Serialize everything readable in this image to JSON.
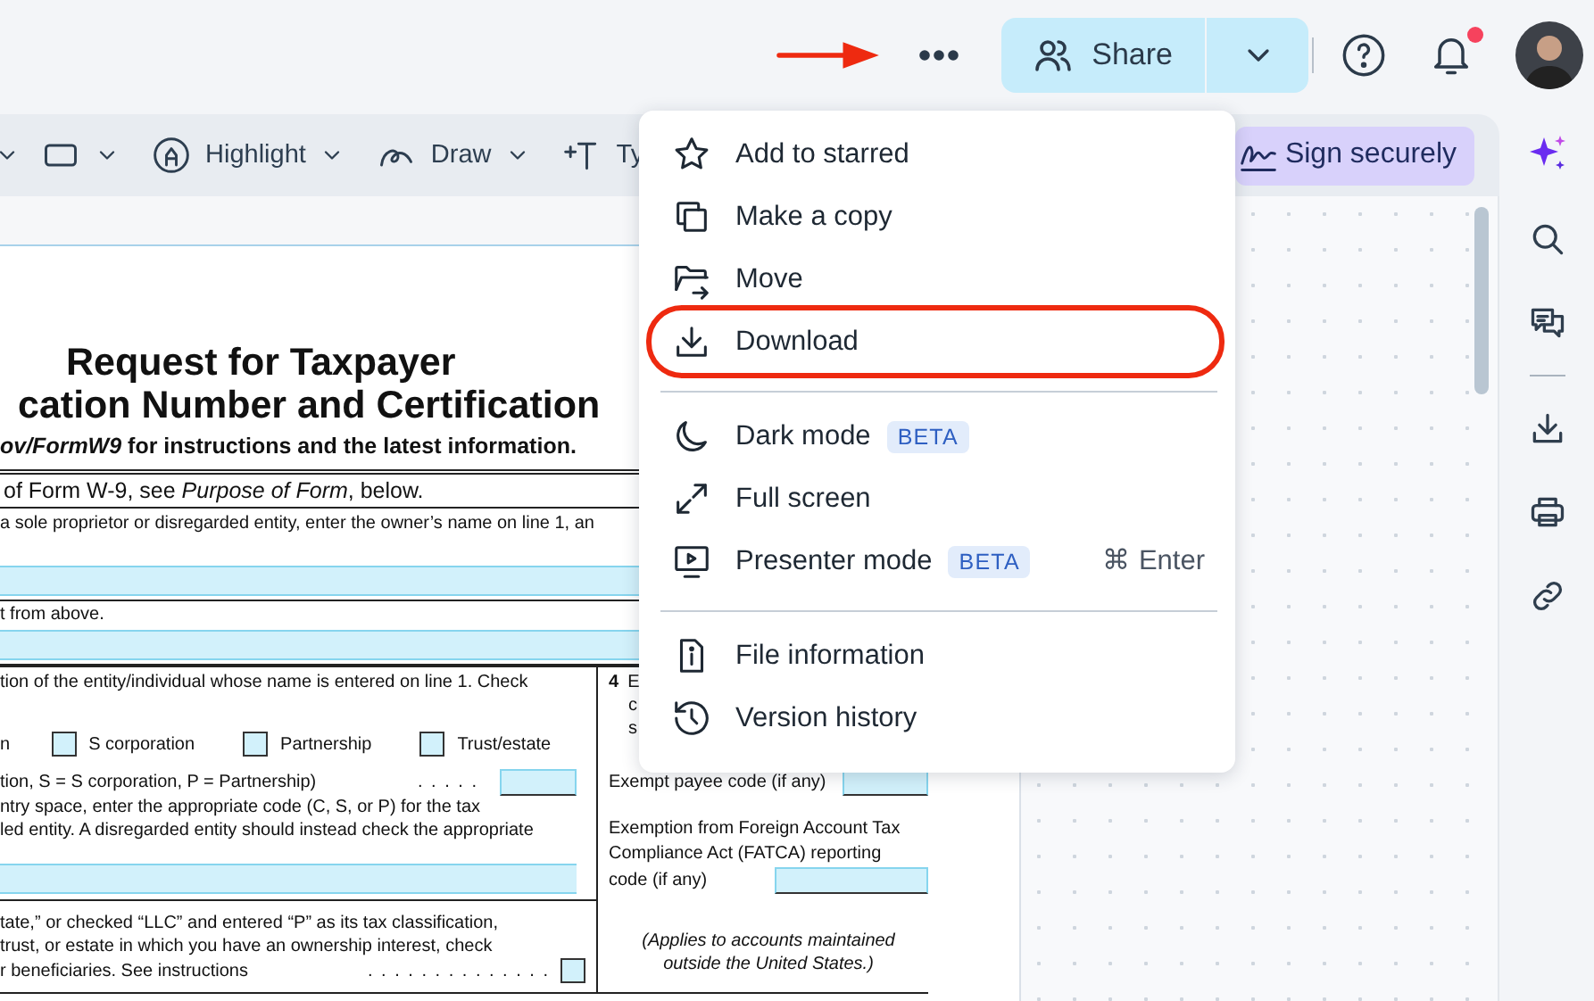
{
  "top_bar": {
    "share": {
      "label": "Share"
    },
    "notifications": {
      "unread": true
    }
  },
  "toolbar": {
    "tools": [
      {
        "kind": "caret"
      },
      {
        "kind": "rectangle"
      },
      {
        "kind": "highlight",
        "label": "Highlight"
      },
      {
        "kind": "draw",
        "label": "Draw"
      },
      {
        "kind": "type",
        "label": "Ty"
      }
    ],
    "sign_button": {
      "label": "Sign securely"
    }
  },
  "menu": {
    "groups": [
      [
        {
          "label": "Add to starred",
          "highlighted": false
        },
        {
          "label": "Make a copy",
          "highlighted": false
        },
        {
          "label": "Move",
          "highlighted": false
        },
        {
          "label": "Download",
          "highlighted": true
        }
      ],
      [
        {
          "label": "Dark mode",
          "badge": "BETA",
          "highlighted": false
        },
        {
          "label": "Full screen",
          "highlighted": false
        },
        {
          "label": "Presenter mode",
          "badge": "BETA",
          "shortcut": "⌘ Enter",
          "highlighted": false
        }
      ],
      [
        {
          "label": "File information",
          "highlighted": false
        },
        {
          "label": "Version history",
          "highlighted": false
        }
      ]
    ]
  },
  "document": {
    "title_lines": [
      "Request for Taxpayer",
      "cation Number and Certification"
    ],
    "subtitle": "*ov/FormW9* for instructions and the latest information.",
    "line_1_note": "of Form W-9, see *Purpose of Form*, below.",
    "line_1_hint": "a sole proprietor or disregarded entity, enter the owner’s name on line 1, an",
    "line_2_hint": "t from above.",
    "line_3_text": "tion of the entity/individual whose name is entered on line 1. Check",
    "checkbox_lead": "n",
    "checkboxes": [
      {
        "label": "S corporation",
        "checked": false
      },
      {
        "label": "Partnership",
        "checked": false
      },
      {
        "label": "Trust/estate",
        "checked": false
      }
    ],
    "llc_lines": [
      {
        "text": "tion, S = S corporation, P = Partnership)",
        "dots": ". . . . ."
      },
      {
        "text": "ntry space, enter the appropriate code (C, S, or P) for the tax"
      },
      {
        "text": "led entity. A disregarded entity should instead check the appropriate"
      }
    ],
    "line_3b_lines": [
      {
        "text": "tate,” or checked “LLC” and entered “P” as its tax classification,"
      },
      {
        "text": "trust, or estate in which you have an ownership interest, check"
      },
      {
        "text": "r beneficiaries. See instructions",
        "dots": ". . . . . . . . . . . . . ."
      }
    ],
    "line_3b_checkbox": {
      "checked": false
    },
    "exemptions": {
      "number": "4",
      "cut_lines": [
        "E",
        "c",
        "s"
      ],
      "payee_label": "Exempt payee code (if any)",
      "fatca_lines": [
        "Exemption from Foreign Account Tax",
        "Compliance Act (FATCA) reporting",
        "code (if any)"
      ],
      "note_lines": [
        "(Applies to accounts maintained",
        "outside the United States.)"
      ]
    }
  }
}
